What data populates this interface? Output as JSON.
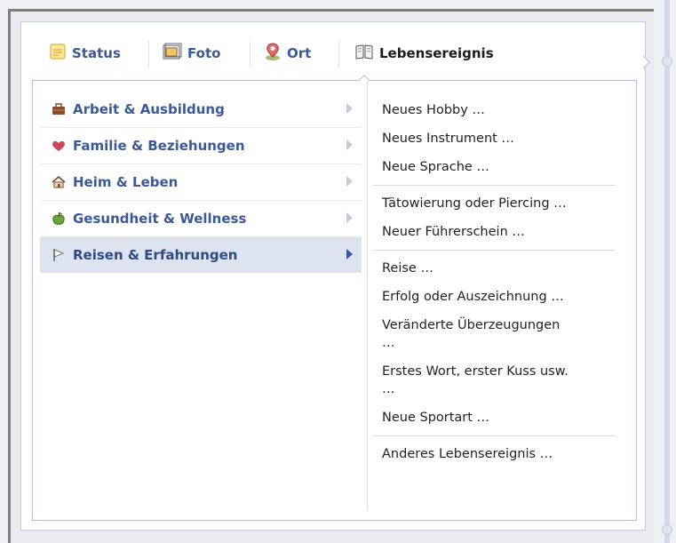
{
  "tabs": [
    {
      "label": "Status",
      "icon": "status-icon"
    },
    {
      "label": "Foto",
      "icon": "photo-icon"
    },
    {
      "label": "Ort",
      "icon": "location-pin-icon"
    },
    {
      "label": "Lebensereignis",
      "icon": "open-book-icon"
    }
  ],
  "active_tab": "Lebensereignis",
  "categories": [
    {
      "label": "Arbeit & Ausbildung",
      "icon": "briefcase-icon"
    },
    {
      "label": "Familie & Beziehungen",
      "icon": "heart-icon"
    },
    {
      "label": "Heim & Leben",
      "icon": "house-icon"
    },
    {
      "label": "Gesundheit & Wellness",
      "icon": "apple-icon"
    },
    {
      "label": "Reisen & Erfahrungen",
      "icon": "flag-icon"
    }
  ],
  "selected_category": "Reisen & Erfahrungen",
  "events": {
    "group1": [
      "Neues Hobby …",
      "Neues Instrument …",
      "Neue Sprache …"
    ],
    "group2": [
      "Tätowierung oder Piercing …",
      "Neuer Führerschein …"
    ],
    "group3_a": [
      "Reise …",
      "Erfolg oder Auszeichnung …"
    ],
    "group3_wrap1": [
      "Veränderte Überzeugungen",
      "…"
    ],
    "group3_wrap2": [
      "Erstes Wort, erster Kuss usw.",
      "…"
    ],
    "group3_b": [
      "Neue Sportart …"
    ],
    "group4": [
      "Anderes Lebensereignis …"
    ]
  },
  "colors": {
    "link": "#3b5998",
    "selected_bg": "#dde3ef",
    "border": "#b3bdd3"
  }
}
